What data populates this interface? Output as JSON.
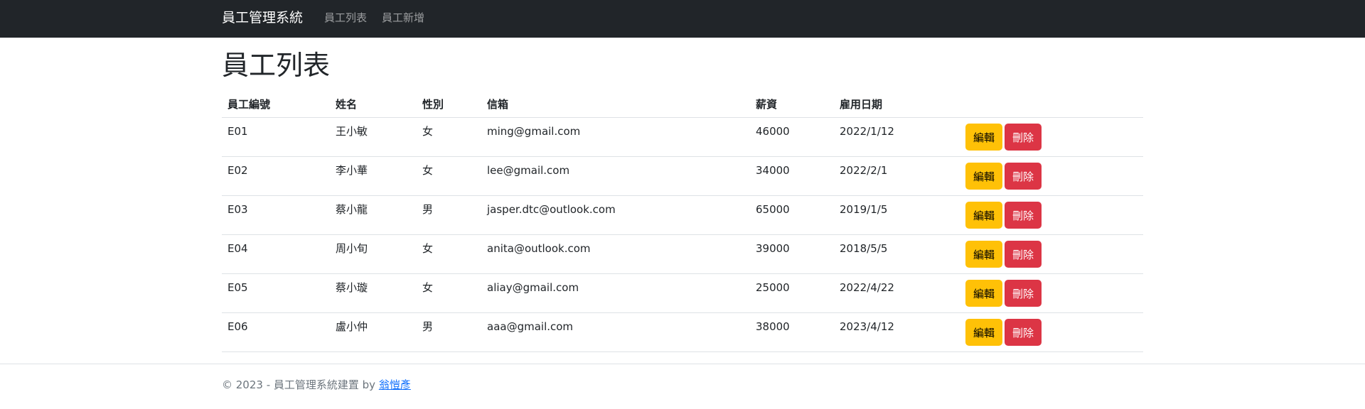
{
  "navbar": {
    "brand": "員工管理系統",
    "links": [
      "員工列表",
      "員工新增"
    ]
  },
  "page": {
    "title": "員工列表"
  },
  "table": {
    "headers": [
      "員工編號",
      "姓名",
      "性別",
      "信箱",
      "薪資",
      "雇用日期",
      ""
    ],
    "rows": [
      {
        "id": "E01",
        "name": "王小敏",
        "gender": "女",
        "email": "ming@gmail.com",
        "salary": "46000",
        "hire_date": "2022/1/12"
      },
      {
        "id": "E02",
        "name": "李小華",
        "gender": "女",
        "email": "lee@gmail.com",
        "salary": "34000",
        "hire_date": "2022/2/1"
      },
      {
        "id": "E03",
        "name": "蔡小龍",
        "gender": "男",
        "email": "jasper.dtc@outlook.com",
        "salary": "65000",
        "hire_date": "2019/1/5"
      },
      {
        "id": "E04",
        "name": "周小旬",
        "gender": "女",
        "email": "anita@outlook.com",
        "salary": "39000",
        "hire_date": "2018/5/5"
      },
      {
        "id": "E05",
        "name": "蔡小璇",
        "gender": "女",
        "email": "aliay@gmail.com",
        "salary": "25000",
        "hire_date": "2022/4/22"
      },
      {
        "id": "E06",
        "name": "盧小仲",
        "gender": "男",
        "email": "aaa@gmail.com",
        "salary": "38000",
        "hire_date": "2023/4/12"
      }
    ],
    "edit_label": "編輯",
    "delete_label": "刪除"
  },
  "footer": {
    "text": "© 2023 - 員工管理系統建置 by ",
    "author": "翁愷彥"
  },
  "colors": {
    "navbar_bg": "#212529",
    "edit_button": "#ffc107",
    "delete_button": "#dc3545",
    "link": "#0d6efd"
  }
}
